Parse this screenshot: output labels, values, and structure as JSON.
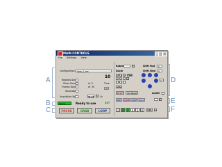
{
  "window": {
    "title": "MAIN CONTROLS",
    "menu": [
      "File",
      "Settings",
      "View"
    ]
  },
  "left": {
    "configuration_label": "Configuration:",
    "configuration_value": "ajop_1_ms",
    "repeats_done_label": "Repeats Done",
    "slices_done_label": "Slices Done",
    "slices_done_value": "0",
    "frames_done_label": "Frames Done",
    "frames_done_value": "34",
    "ten_value": "10",
    "time_label": "Time",
    "acquisition_label": "Acquisition Rp",
    "start_label": "Start",
    "status_box": "Ready",
    "status_text": "Ready to use",
    "set_label": "SET",
    "focus_label": "FOCUS",
    "grab_label": "GRAB",
    "loop_label": "LOOP"
  },
  "right": {
    "rotate_label": "Rotate",
    "zoom_label": "Zoom",
    "shift_fast_label": "Shift Fast",
    "shift_fast_value": "0",
    "shift_slow_label": "Shift Slow",
    "shift_slow_value": "0",
    "zoom_digits": [
      "0",
      "0",
      "1"
    ],
    "full_label": "Full",
    "step_value": "0.1",
    "reset_label": "RESET",
    "set_reset_label": "Set Reset",
    "align_label": "ALIGN",
    "mode_buttons": [
      "ROI",
      "UNIS",
      "Add",
      "Grey"
    ],
    "pages": [
      "1",
      "2",
      "3",
      "4",
      "5",
      "6"
    ],
    "crl_label": "CRL"
  },
  "callouts": {
    "a": "A",
    "b": "B",
    "c": "C",
    "d": "D",
    "e": "E",
    "f": "F"
  },
  "colors": {
    "title_bar": "#0a246a",
    "status_green": "#2bb52b",
    "focus_red": "#c0281e",
    "grab_green": "#1e8a1e",
    "loop_blue": "#1e3ca0",
    "callout": "#6a8fbf"
  }
}
